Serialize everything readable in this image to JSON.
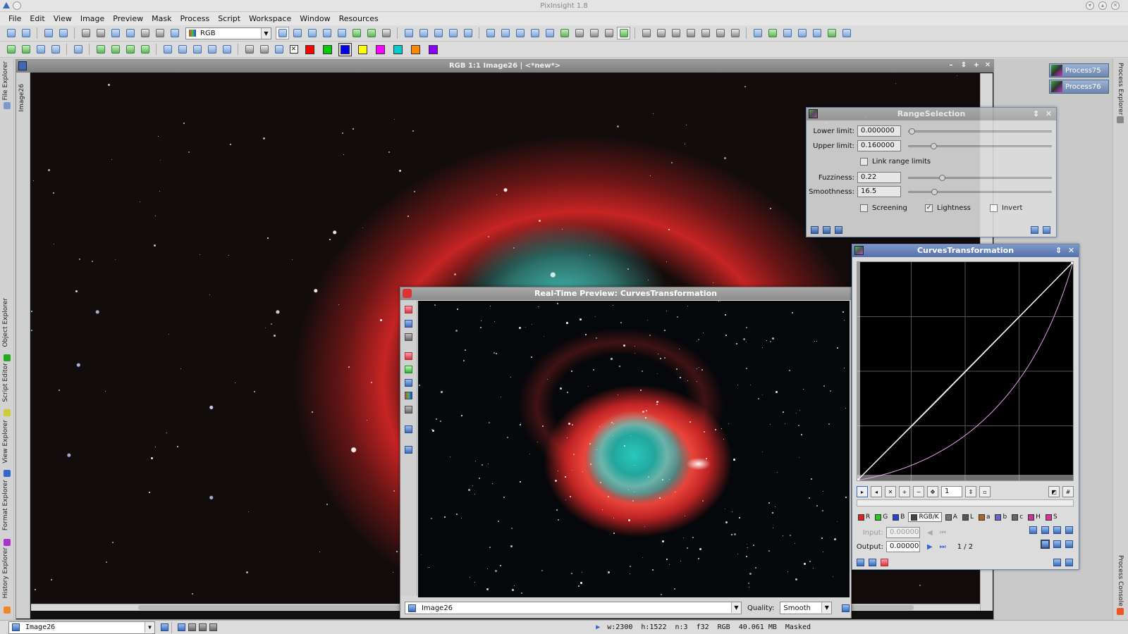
{
  "window": {
    "title": "PixInsight 1.8"
  },
  "menu": [
    "File",
    "Edit",
    "View",
    "Image",
    "Preview",
    "Mask",
    "Process",
    "Script",
    "Workspace",
    "Window",
    "Resources"
  ],
  "toolbar": {
    "color_mode": "RGB",
    "swatch_colors": [
      "#ff0000",
      "#00cc00",
      "#0000ee",
      "#ffff00",
      "#ff00ff",
      "#00cccc",
      "#ff8800",
      "#8800ff"
    ]
  },
  "left_dock": [
    "File Explorer",
    "Object Explorer",
    "Script Editor",
    "View Explorer",
    "Format Explorer",
    "History Explorer"
  ],
  "right_dock": [
    "Process Explorer",
    "Process Console"
  ],
  "image_window": {
    "title": "RGB 1:1 Image26 | <*new*>",
    "vertical_tab": "Image26"
  },
  "process_icons": [
    "Process75",
    "Process76"
  ],
  "range_selection": {
    "title": "RangeSelection",
    "lower_label": "Lower limit:",
    "lower_value": "0.000000",
    "lower_level": 0.0,
    "upper_label": "Upper limit:",
    "upper_value": "0.160000",
    "upper_level": 0.16,
    "link_label": "Link range limits",
    "fuzz_label": "Fuzziness:",
    "fuzz_value": "0.22",
    "fuzz_level": 0.22,
    "smooth_label": "Smoothness:",
    "smooth_value": "16.5",
    "smooth_level": 0.165,
    "screening_label": "Screening",
    "lightness_label": "Lightness",
    "invert_label": "Invert"
  },
  "curves": {
    "title": "CurvesTransformation",
    "zoom": "1",
    "channels": [
      "R",
      "G",
      "B",
      "RGB/K",
      "A",
      "L",
      "a",
      "b",
      "c",
      "H",
      "S"
    ],
    "channel_colors": [
      "#dd2222",
      "#22cc22",
      "#2244dd",
      "#444444",
      "#777777",
      "#555555",
      "#aa6622",
      "#6666cc",
      "#666666",
      "#cc3399",
      "#dd3399"
    ],
    "input_label": "Input:",
    "input_value": "0.00000",
    "output_label": "Output:",
    "output_value": "0.00000",
    "point_index": "1 / 2"
  },
  "rtp": {
    "title": "Real-Time Preview: CurvesTransformation",
    "view": "Image26",
    "quality_label": "Quality:",
    "quality_value": "Smooth"
  },
  "status": {
    "view": "Image26",
    "width": "w:2300",
    "height": "h:1522",
    "channels": "n:3",
    "format": "f32",
    "color_space": "RGB",
    "size": "40.061 MB",
    "mask": "Masked"
  }
}
